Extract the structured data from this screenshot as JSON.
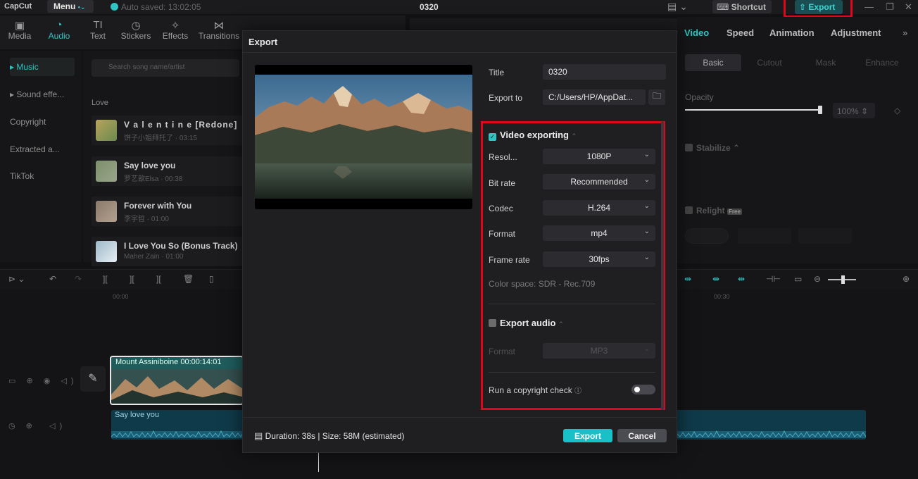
{
  "titlebar": {
    "logo": "CapCut",
    "menu_label": "Menu",
    "autosave": "Auto saved: 13:02:05",
    "project_name": "0320",
    "shortcut_label": "Shortcut",
    "export_label": "Export"
  },
  "media_toolbar": {
    "items": [
      "Media",
      "Audio",
      "Text",
      "Stickers",
      "Effects",
      "Transitions"
    ]
  },
  "audio_nav": {
    "items": [
      "Music",
      "Sound effe...",
      "Copyright",
      "Extracted a...",
      "TikTok"
    ]
  },
  "music_library": {
    "search_placeholder": "Search song name/artist",
    "section": "Love",
    "songs": [
      {
        "title": "V a l e n t i n e [Redone]",
        "meta": "饼子小姐拜托了 · 03:15"
      },
      {
        "title": "Say love you",
        "meta": "罗艺歆Elsa · 00:38"
      },
      {
        "title": "Forever with You",
        "meta": "李宇哲 · 01:00"
      },
      {
        "title": "I Love You So (Bonus Track)",
        "meta": "Maher Zain · 01:00"
      }
    ]
  },
  "properties": {
    "tabs": [
      "Video",
      "Speed",
      "Animation",
      "Adjustment"
    ],
    "subtabs": [
      "Basic",
      "Cutout",
      "Mask",
      "Enhance"
    ],
    "opacity_label": "Opacity",
    "opacity_value": "100%",
    "opacity_level": 1.0,
    "stabilize_label": "Stabilize",
    "relight_label": "Relight",
    "relight_badge": "Free"
  },
  "timeline": {
    "ruler_start": "00:00",
    "ruler_mid": "00:30",
    "video_clip": {
      "name": "Mount Assiniboine",
      "duration": "00:00:14:01"
    },
    "audio_clip": {
      "name": "Say love you"
    }
  },
  "export_dialog": {
    "title": "Export",
    "title_label": "Title",
    "title_value": "0320",
    "export_to_label": "Export to",
    "export_to_value": "C:/Users/HP/AppDat...",
    "video_section": "Video exporting",
    "video_enabled": true,
    "resolution_label": "Resol...",
    "resolution_value": "1080P",
    "bitrate_label": "Bit rate",
    "bitrate_value": "Recommended",
    "codec_label": "Codec",
    "codec_value": "H.264",
    "format_label": "Format",
    "format_value": "mp4",
    "framerate_label": "Frame rate",
    "framerate_value": "30fps",
    "color_space": "Color space: SDR - Rec.709",
    "audio_section": "Export audio",
    "audio_enabled": false,
    "audio_format_label": "Format",
    "audio_format_value": "MP3",
    "copyright_label": "Run a copyright check",
    "copyright_enabled": false,
    "footer_info": "Duration: 38s | Size: 58M (estimated)",
    "export_button": "Export",
    "cancel_button": "Cancel"
  },
  "colors": {
    "accent": "#2ec5c5",
    "highlight": "#e0061b",
    "background": "#121214",
    "dialog": "#1f1f22"
  }
}
